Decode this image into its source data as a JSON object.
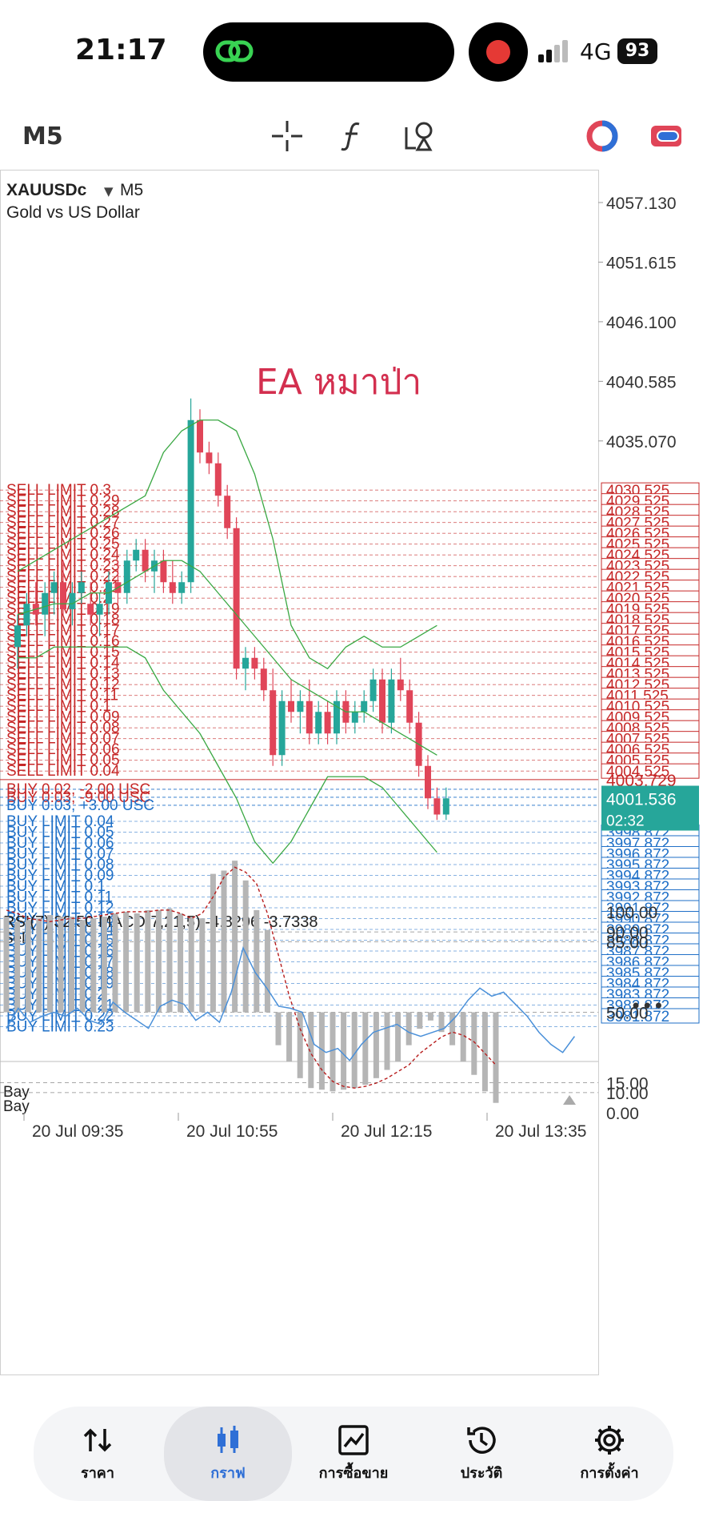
{
  "status": {
    "time": "21:17",
    "network": "4G",
    "battery": "93"
  },
  "toolbar": {
    "timeframe": "M5"
  },
  "chart": {
    "symbol": "XAUUSDc",
    "symbol_tf": "M5",
    "description": "Gold vs US Dollar",
    "annotation": "EA หมาป่า",
    "price_axis": [
      "4057.130",
      "4051.615",
      "4046.100",
      "4040.585",
      "4035.070"
    ],
    "time_axis": [
      "20 Jul 09:35",
      "20 Jul 10:55",
      "20 Jul 12:15",
      "20 Jul 13:35"
    ],
    "current_price": "4001.536",
    "countdown": "02:32",
    "bid_line": "4003.729",
    "sell_limits": [
      "SELL LIMIT 0.3",
      "SELL LIMIT 0.29",
      "SELL LIMIT 0.28",
      "SELL LIMIT 0.27",
      "SELL LIMIT 0.26",
      "SELL LIMIT 0.25",
      "SELL LIMIT 0.24",
      "SELL LIMIT 0.23",
      "SELL LIMIT 0.22",
      "SELL LIMIT 0.21",
      "SELL LIMIT 0.2",
      "SELL LIMIT 0.19",
      "SELL LIMIT 0.18",
      "SELL LIMIT 0.17",
      "SELL LIMIT 0.16",
      "SELL LIMIT 0.15",
      "SELL LIMIT 0.14",
      "SELL LIMIT 0.13",
      "SELL LIMIT 0.12",
      "SELL LIMIT 0.11",
      "SELL LIMIT 0.1",
      "SELL LIMIT 0.09",
      "SELL LIMIT 0.08",
      "SELL LIMIT 0.07",
      "SELL LIMIT 0.06",
      "SELL LIMIT 0.05",
      "SELL LIMIT 0.04"
    ],
    "sell_prices": [
      "4030.525",
      "4029.525",
      "4028.525",
      "4027.525",
      "4026.525",
      "4025.525",
      "4024.525",
      "4023.525",
      "4022.525",
      "4021.525",
      "4020.525",
      "4019.525",
      "4018.525",
      "4017.525",
      "4016.525",
      "4015.525",
      "4014.525",
      "4013.525",
      "4012.525",
      "4011.525",
      "4010.525",
      "4009.525",
      "4008.525",
      "4007.525",
      "4006.525",
      "4005.525",
      "4004.525"
    ],
    "buy_positions": [
      "BUY 0.02, -2.00 USC",
      "BUY 0.03, -9.00 USC",
      "BUY 0.03, +3.00 USC"
    ],
    "buy_limits": [
      "BUY LIMIT 0.04",
      "BUY LIMIT 0.05",
      "BUY LIMIT 0.06",
      "BUY LIMIT 0.07",
      "BUY LIMIT 0.08",
      "BUY LIMIT 0.09",
      "BUY LIMIT 0.1",
      "BUY LIMIT 0.11",
      "BUY LIMIT 0.12",
      "BUY LIMIT 0.13",
      "BUY LIMIT 0.14",
      "BUY LIMIT 0.15",
      "BUY LIMIT 0.16",
      "BUY LIMIT 0.17",
      "BUY LIMIT 0.18",
      "BUY LIMIT 0.19",
      "BUY LIMIT 0.2",
      "BUY LIMIT 0.21",
      "BUY LIMIT 0.22",
      "BUY LIMIT 0.23"
    ],
    "buy_prices": [
      "3998.872",
      "3997.872",
      "3996.872",
      "3995.872",
      "3994.872",
      "3993.872",
      "3992.872",
      "3991.872",
      "3990.872",
      "3989.872",
      "3988.872",
      "3987.872",
      "3986.872",
      "3985.872",
      "3984.872",
      "3983.872",
      "3982.872",
      "3981.872"
    ],
    "colors": {
      "bull": "#26a69a",
      "bear": "#e04558",
      "sell": "#c62828",
      "buy": "#1e6fc7",
      "band": "#3aa843",
      "rsi": "#4a90d9",
      "signal": "#b71c1c",
      "hist": "#b5b5b5"
    }
  },
  "indicator": {
    "title": "RSI(7) 32.50 MACD(7,21,5) -4.8296 -3.7338",
    "sell_label": "Sell",
    "bay_label_1": "Bay",
    "bay_label_2": "Bay",
    "levels": [
      "100.00",
      "90.00",
      "85.00",
      "50.00",
      "15.00",
      "10.00",
      "0.00"
    ],
    "rsi": [
      42,
      52,
      45,
      48,
      50,
      48,
      52,
      46,
      44,
      55,
      50,
      46,
      42,
      53,
      56,
      54,
      46,
      50,
      45,
      60,
      82,
      70,
      62,
      53,
      52,
      50,
      34,
      30,
      32,
      26,
      34,
      40,
      42,
      44,
      40,
      38,
      40,
      42,
      48,
      56,
      62,
      58,
      60,
      54,
      48,
      40,
      34,
      30,
      38
    ],
    "macd_hist": [
      58,
      55,
      56,
      57,
      59,
      58,
      58,
      56,
      57,
      58,
      60,
      61,
      60,
      62,
      62,
      63,
      60,
      58,
      57,
      84,
      86,
      92,
      80,
      62,
      50,
      -20,
      -30,
      -40,
      -46,
      -47,
      -48,
      -47,
      -46,
      -44,
      -40,
      -35,
      -30,
      -20,
      -10,
      -5,
      -12,
      -20,
      -30,
      -38,
      -48,
      -55
    ],
    "macd_signal": [
      62,
      60,
      57,
      56,
      55,
      56,
      57,
      57,
      58,
      59,
      60,
      61,
      61,
      61,
      62,
      62,
      60,
      57,
      60,
      70,
      82,
      88,
      85,
      78,
      60,
      35,
      10,
      -10,
      -25,
      -35,
      -42,
      -45,
      -46,
      -45,
      -43,
      -40,
      -36,
      -32,
      -25,
      -20,
      -15,
      -12,
      -14,
      -18,
      -25,
      -32
    ]
  },
  "nav": {
    "price": "ราคา",
    "chart": "กราฟ",
    "trade": "การซื้อขาย",
    "history": "ประวัติ",
    "settings": "การตั้งค่า"
  }
}
